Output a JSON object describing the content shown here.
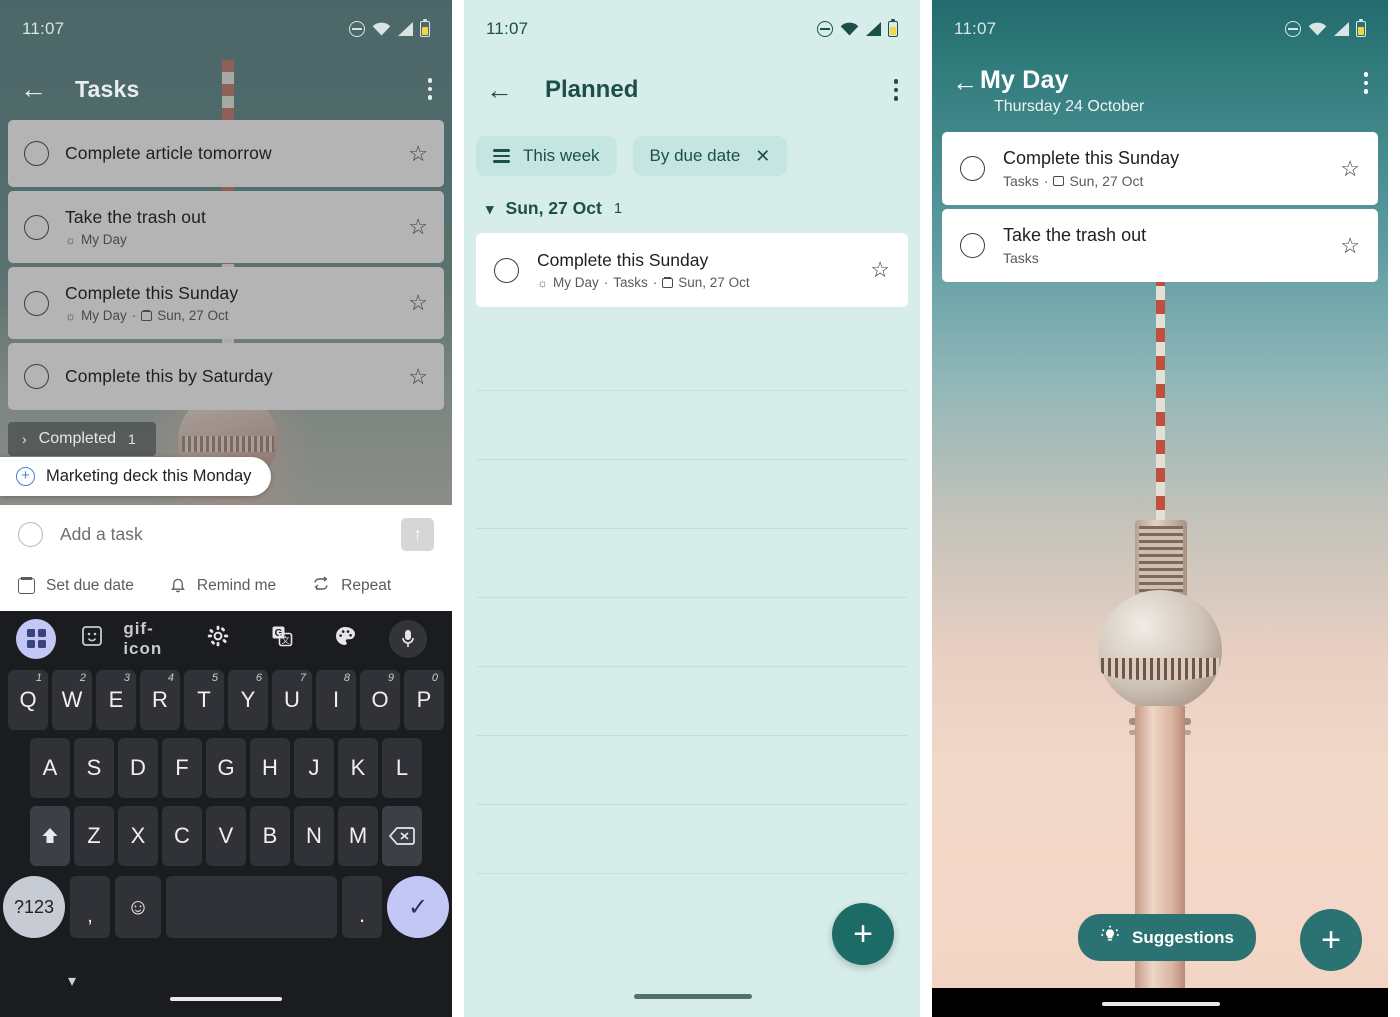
{
  "status_bar": {
    "time": "11:07",
    "icons": [
      "dnd-icon",
      "wifi-icon",
      "signal-icon",
      "battery-icon"
    ]
  },
  "colors": {
    "teal_dark": "#1d4f4a",
    "teal_accent": "#1d6b66",
    "mint_bg": "#d6edea",
    "chip_bg": "#c5e5e1",
    "keyboard_bg": "#1b1c20",
    "enter_key": "#c2c7f5"
  },
  "panel_tasks": {
    "app_bar": {
      "back_icon": "arrow-left-icon",
      "title": "Tasks",
      "overflow_icon": "more-vertical-icon"
    },
    "tasks": [
      {
        "title": "Complete article tomorrow",
        "meta": "",
        "has_myday": false,
        "has_date": false,
        "date": "",
        "star_icon": "star-outline-icon"
      },
      {
        "title": "Take the trash out",
        "meta": "My Day",
        "has_myday": true,
        "has_date": false,
        "date": "",
        "star_icon": "star-outline-icon"
      },
      {
        "title": "Complete this Sunday",
        "meta": "My Day",
        "has_myday": true,
        "has_date": true,
        "date": "Sun, 27 Oct",
        "star_icon": "star-outline-icon"
      },
      {
        "title": "Complete this by Saturday",
        "meta": "",
        "has_myday": false,
        "has_date": false,
        "date": "",
        "star_icon": "star-outline-icon"
      }
    ],
    "completed_section": {
      "chevron_icon": "chevron-right-icon",
      "label": "Completed",
      "count": "1"
    },
    "suggestion_chip": {
      "plus_icon": "plus-circle-icon",
      "label": "Marketing deck this Monday"
    },
    "compose": {
      "placeholder": "Add a task",
      "send_icon": "arrow-up-icon",
      "actions": [
        {
          "icon": "calendar-icon",
          "label": "Set due date"
        },
        {
          "icon": "bell-icon",
          "label": "Remind me"
        },
        {
          "icon": "repeat-icon",
          "label": "Repeat"
        }
      ]
    },
    "keyboard": {
      "toolbar": [
        "grid-icon",
        "sticker-icon",
        "gif-icon",
        "gear-icon",
        "translate-icon",
        "palette-icon",
        "microphone-icon"
      ],
      "row1": [
        {
          "k": "Q",
          "n": "1"
        },
        {
          "k": "W",
          "n": "2"
        },
        {
          "k": "E",
          "n": "3"
        },
        {
          "k": "R",
          "n": "4"
        },
        {
          "k": "T",
          "n": "5"
        },
        {
          "k": "Y",
          "n": "6"
        },
        {
          "k": "U",
          "n": "7"
        },
        {
          "k": "I",
          "n": "8"
        },
        {
          "k": "O",
          "n": "9"
        },
        {
          "k": "P",
          "n": "0"
        }
      ],
      "row2": [
        "A",
        "S",
        "D",
        "F",
        "G",
        "H",
        "J",
        "K",
        "L"
      ],
      "row3_shift_icon": "shift-icon",
      "row3": [
        "Z",
        "X",
        "C",
        "V",
        "B",
        "N",
        "M"
      ],
      "row3_backspace_icon": "backspace-icon",
      "row4": {
        "symbols_label": "?123",
        "comma": ",",
        "emoji_icon": "emoji-icon",
        "space": "",
        "period": ".",
        "enter_icon": "check-icon"
      },
      "collapse_icon": "chevron-down-icon"
    }
  },
  "panel_planned": {
    "app_bar": {
      "back_icon": "arrow-left-icon",
      "title": "Planned",
      "overflow_icon": "more-vertical-icon"
    },
    "chips": [
      {
        "icon": "list-filter-icon",
        "label": "This week",
        "dismissible": false,
        "close_icon": ""
      },
      {
        "icon": "",
        "label": "By due date",
        "dismissible": true,
        "close_icon": "close-icon"
      }
    ],
    "group": {
      "chevron_icon": "chevron-down-icon",
      "label": "Sun, 27 Oct",
      "count": "1"
    },
    "task": {
      "title": "Complete this Sunday",
      "myday": "My Day",
      "list": "Tasks",
      "date": "Sun, 27 Oct",
      "star_icon": "star-outline-icon"
    },
    "fab": {
      "icon": "plus-icon"
    }
  },
  "panel_myday": {
    "app_bar": {
      "back_icon": "arrow-left-icon",
      "title": "My Day",
      "subtitle": "Thursday 24 October",
      "overflow_icon": "more-vertical-icon"
    },
    "tasks": [
      {
        "title": "Complete this Sunday",
        "list": "Tasks",
        "has_date": true,
        "date": "Sun, 27 Oct",
        "star_icon": "star-outline-icon"
      },
      {
        "title": "Take the trash out",
        "list": "Tasks",
        "has_date": false,
        "date": "",
        "star_icon": "star-outline-icon"
      }
    ],
    "suggestions_button": {
      "icon": "lightbulb-icon",
      "label": "Suggestions"
    },
    "fab": {
      "icon": "plus-icon"
    }
  }
}
